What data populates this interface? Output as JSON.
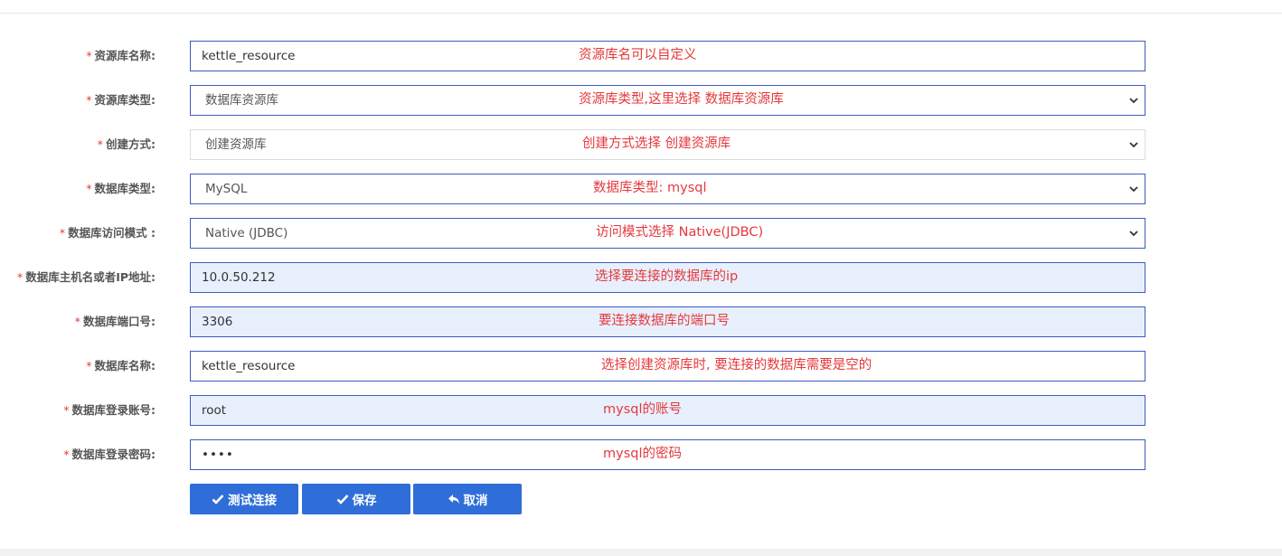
{
  "form": {
    "rows": [
      {
        "label": "资源库名称:",
        "value": "kettle_resource",
        "note": "资源库名可以自定义"
      },
      {
        "label": "资源库类型:",
        "value": "数据库资源库",
        "note": "资源库类型,这里选择 数据库资源库"
      },
      {
        "label": "创建方式:",
        "value": "创建资源库",
        "note": "创建方式选择 创建资源库"
      },
      {
        "label": "数据库类型:",
        "value": "MySQL",
        "note": "数据库类型: mysql"
      },
      {
        "label": "数据库访问模式 :",
        "value": "Native (JDBC)",
        "note": "访问模式选择 Native(JDBC)"
      },
      {
        "label": "数据库主机名或者IP地址:",
        "value": "10.0.50.212",
        "note": "选择要连接的数据库的ip"
      },
      {
        "label": "数据库端口号:",
        "value": "3306",
        "note": "要连接数据库的端口号"
      },
      {
        "label": "数据库名称:",
        "value": "kettle_resource",
        "note": "选择创建资源库时, 要连接的数据库需要是空的"
      },
      {
        "label": "数据库登录账号:",
        "value": "root",
        "note": "mysql的账号"
      },
      {
        "label": "数据库登录密码:",
        "value": "••••",
        "note": "mysql的密码"
      }
    ],
    "required_mark": "*"
  },
  "buttons": {
    "test": "测试连接",
    "save": "保存",
    "cancel": "取消"
  },
  "colors": {
    "accent": "#2f6ed8",
    "required": "#e4393c",
    "annotation": "#e4393c",
    "autofill_bg": "#e8f0fe"
  },
  "icons": {
    "test": "check-icon",
    "save": "check-icon",
    "cancel": "reply-icon",
    "dropdown": "chevron-down-icon"
  }
}
